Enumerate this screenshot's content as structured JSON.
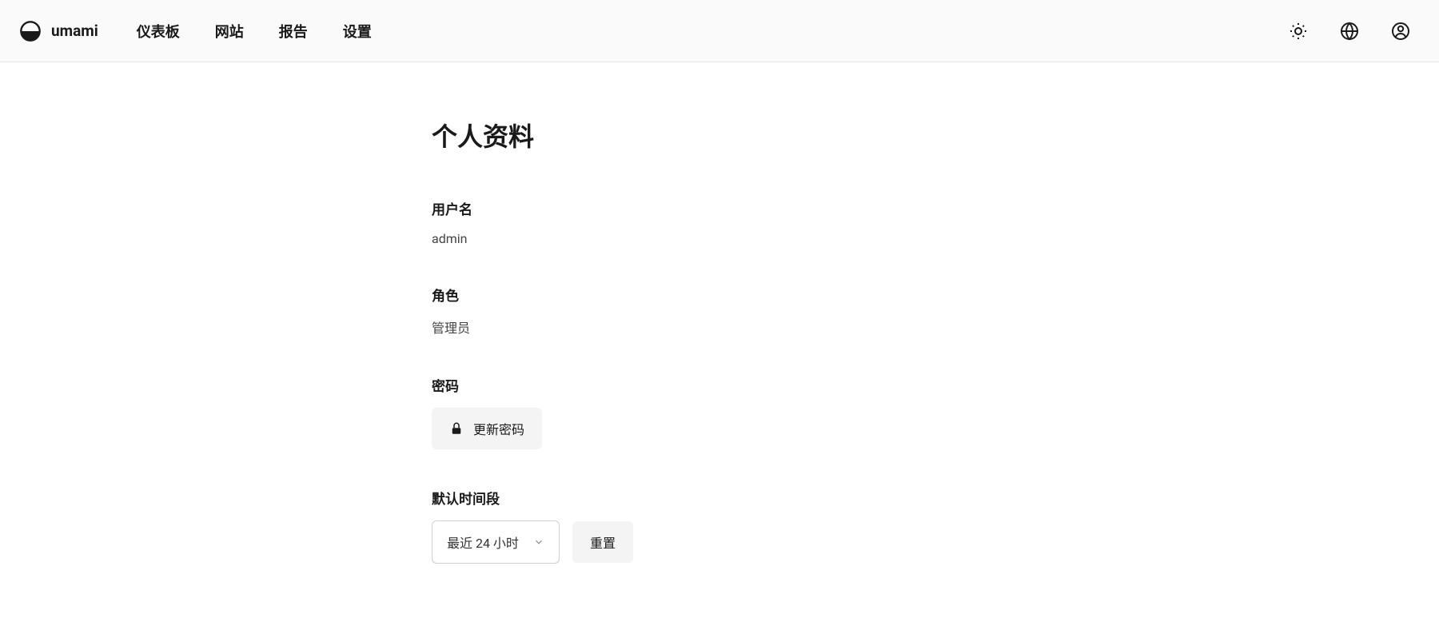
{
  "brand": {
    "name": "umami"
  },
  "nav": {
    "dashboard": "仪表板",
    "websites": "网站",
    "reports": "报告",
    "settings": "设置"
  },
  "page": {
    "title": "个人资料"
  },
  "profile": {
    "username_label": "用户名",
    "username_value": "admin",
    "role_label": "角色",
    "role_value": "管理员",
    "password_label": "密码",
    "update_password_button": "更新密码",
    "default_daterange_label": "默认时间段",
    "daterange_selected": "最近 24 小时",
    "reset_button": "重置"
  }
}
